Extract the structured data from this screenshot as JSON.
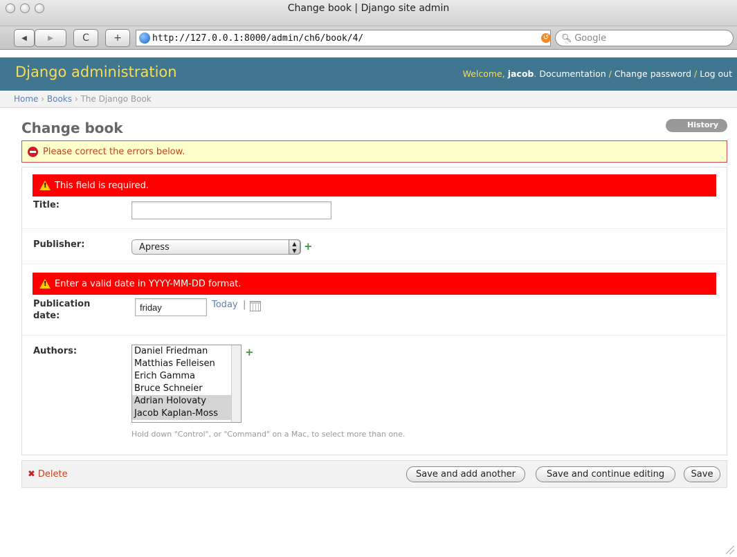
{
  "window": {
    "title": "Change book | Django site admin"
  },
  "browser": {
    "back_glyph": "◀",
    "forward_glyph": "▶",
    "reload_glyph": "C",
    "add_glyph": "+",
    "url": "http://127.0.0.1:8000/admin/ch6/book/4/",
    "search_placeholder": "Google"
  },
  "header": {
    "branding": "Django administration",
    "welcome": "Welcome, ",
    "username": "jacob",
    "period": ". ",
    "documentation": "Documentation",
    "sep1": " / ",
    "change_password": "Change password",
    "sep2": " / ",
    "logout": "Log out"
  },
  "breadcrumbs": {
    "home": "Home",
    "sep": " › ",
    "books": "Books",
    "current": "The Django Book"
  },
  "page": {
    "title": "Change book",
    "history": "History",
    "errornote": "Please correct the errors below."
  },
  "form": {
    "title": {
      "error": "This field is required.",
      "label": "Title:",
      "value": ""
    },
    "publisher": {
      "label": "Publisher:",
      "selected": "Apress"
    },
    "publication_date": {
      "error": "Enter a valid date in YYYY-MM-DD format.",
      "label_line1": "Publication",
      "label_line2": "date:",
      "value": "friday",
      "today": "Today",
      "sep": "|"
    },
    "authors": {
      "label": "Authors:",
      "options": [
        {
          "name": "Daniel Friedman",
          "selected": false
        },
        {
          "name": "Matthias Felleisen",
          "selected": false
        },
        {
          "name": "Erich Gamma",
          "selected": false
        },
        {
          "name": "Bruce Schneier",
          "selected": false
        },
        {
          "name": "Adrian Holovaty",
          "selected": true
        },
        {
          "name": "Jacob Kaplan-Moss",
          "selected": true
        }
      ],
      "help": "Hold down \"Control\", or \"Command\" on a Mac, to select more than one."
    }
  },
  "submit": {
    "delete": "Delete",
    "save_add": "Save and add another",
    "save_continue": "Save and continue editing",
    "save": "Save"
  },
  "icons": {
    "add": "+",
    "delete": "✖"
  },
  "colors": {
    "header_bg": "#417690",
    "branding": "#f5dd5d",
    "error_bar": "#ff0000",
    "errornote_bg": "#ffffcc",
    "link": "#5b80b2"
  }
}
